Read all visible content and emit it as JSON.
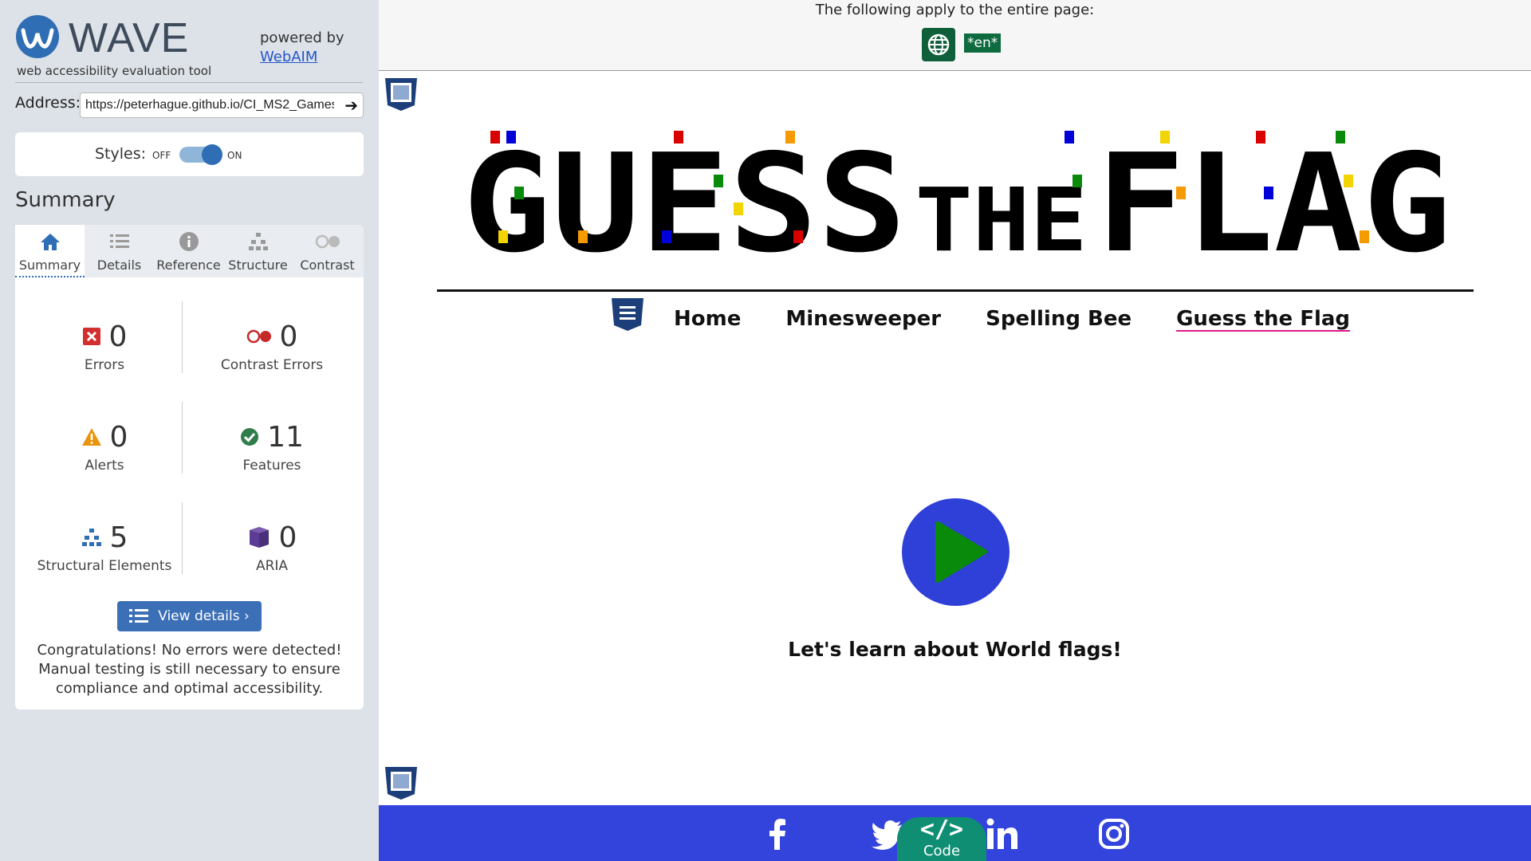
{
  "wave": {
    "title": "WAVE",
    "subtitle": "web accessibility evaluation tool",
    "powered_by": "powered by",
    "webaim_link": "WebAIM",
    "address_label": "Address:",
    "address_value": "https://peterhague.github.io/CI_MS2_Games/",
    "styles_label": "Styles:",
    "styles_off": "OFF",
    "styles_on": "ON",
    "summary_heading": "Summary",
    "tabs": [
      {
        "label": "Summary",
        "icon": "home-icon"
      },
      {
        "label": "Details",
        "icon": "list-icon"
      },
      {
        "label": "Reference",
        "icon": "info-icon"
      },
      {
        "label": "Structure",
        "icon": "hierarchy-icon"
      },
      {
        "label": "Contrast",
        "icon": "contrast-icon"
      }
    ],
    "stats": {
      "errors": {
        "count": "0",
        "label": "Errors"
      },
      "contrast_errors": {
        "count": "0",
        "label": "Contrast Errors"
      },
      "alerts": {
        "count": "0",
        "label": "Alerts"
      },
      "features": {
        "count": "11",
        "label": "Features"
      },
      "structural": {
        "count": "5",
        "label": "Structural Elements"
      },
      "aria": {
        "count": "0",
        "label": "ARIA"
      }
    },
    "view_details": "View details ›",
    "congrats": "Congratulations! No errors were detected! Manual testing is still necessary to ensure compliance and optimal accessibility."
  },
  "page": {
    "apply_text": "The following apply to the entire page:",
    "lang_badge": "*en*",
    "title_words": [
      "GUESS",
      "THE",
      "FLAG"
    ],
    "nav": [
      "Home",
      "Minesweeper",
      "Spelling Bee",
      "Guess the Flag"
    ],
    "play_caption": "Let's learn about World flags!",
    "code_label": "Code",
    "code_glyph": "</>"
  },
  "colors": {
    "sidebar_bg": "#dde2e8",
    "wave_blue": "#2f6db4",
    "footer_blue": "#3344dd",
    "play_blue": "#2f40d8",
    "play_green": "#0a8a0a",
    "nav_underline": "#e0198a",
    "code_teal": "#0f8e74"
  }
}
